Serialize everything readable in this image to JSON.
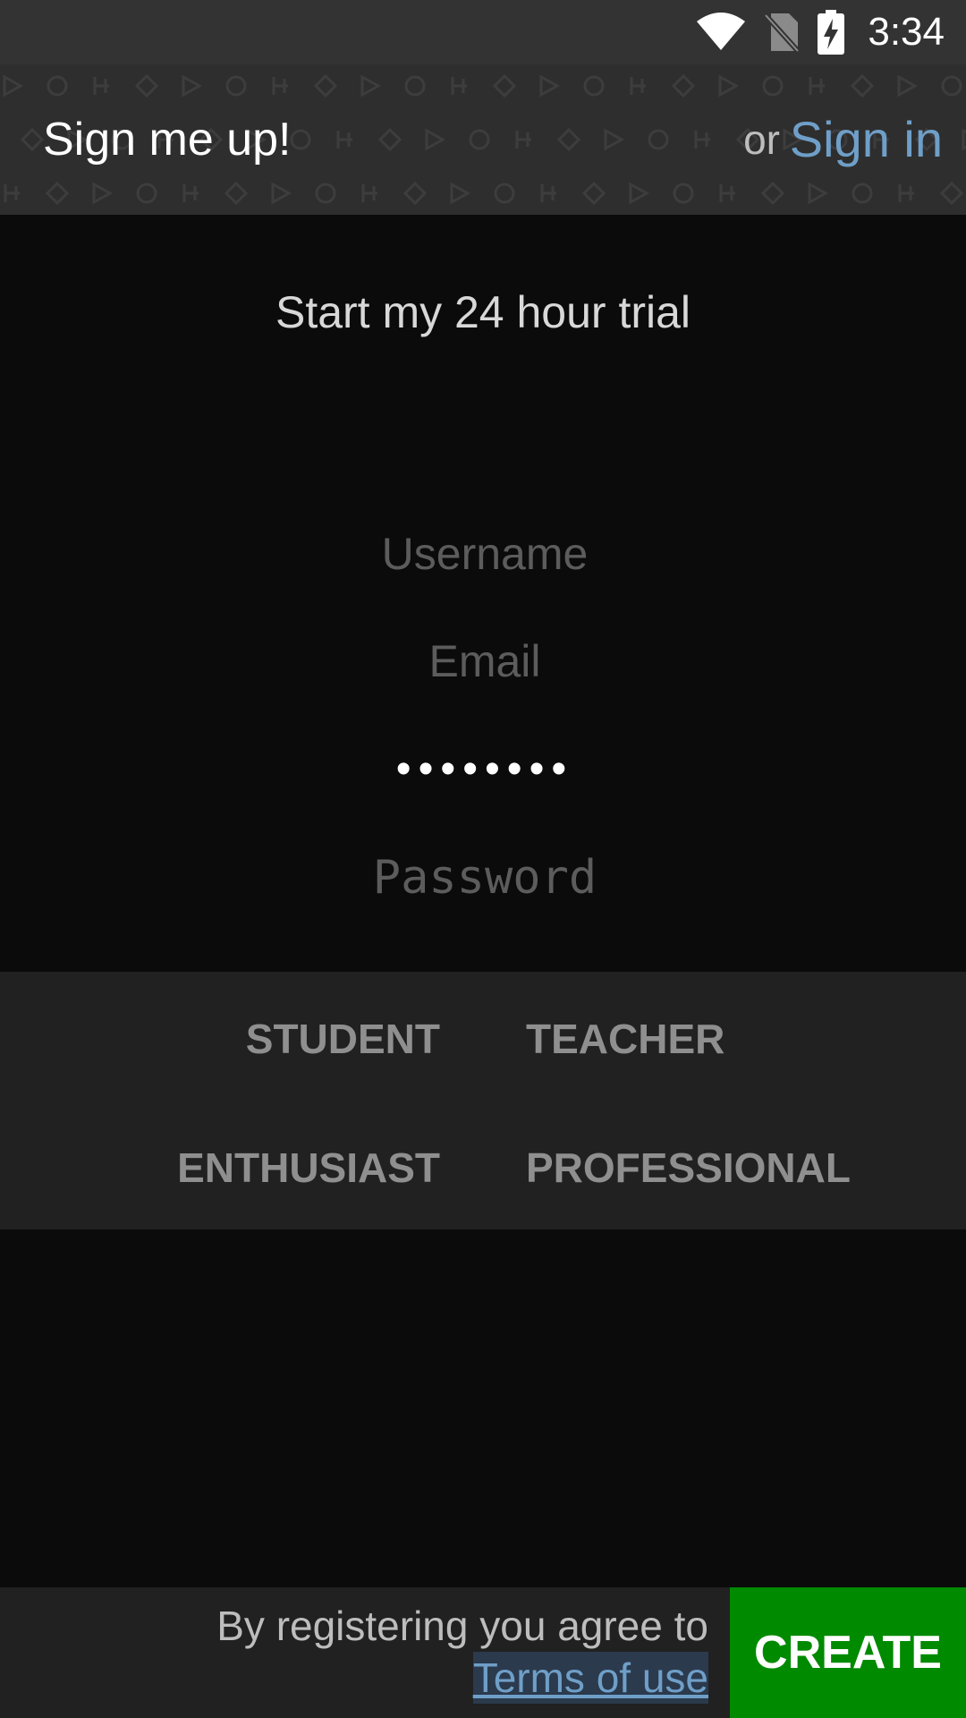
{
  "status_bar": {
    "time": "3:34",
    "icons": [
      "wifi-icon",
      "no-sim-icon",
      "battery-charging-icon"
    ]
  },
  "header": {
    "title": "Sign me up!",
    "or_text": "or",
    "signin_label": "Sign in"
  },
  "form": {
    "subtitle": "Start my 24 hour trial",
    "username": {
      "placeholder": "Username",
      "value": ""
    },
    "email": {
      "placeholder": "Email",
      "value": ""
    },
    "password": {
      "placeholder": "",
      "value": "••••••••"
    },
    "password_confirm": {
      "placeholder": "Password",
      "value": ""
    }
  },
  "roles": {
    "student": "STUDENT",
    "teacher": "TEACHER",
    "enthusiast": "ENTHUSIAST",
    "professional": "PROFESSIONAL"
  },
  "footer": {
    "agree_text": "By registering you agree to",
    "terms_label": "Terms of use",
    "create_label": "CREATE"
  },
  "colors": {
    "accent_link": "#6f9fc8",
    "create_button": "#008a00",
    "background": "#0b0b0b"
  }
}
